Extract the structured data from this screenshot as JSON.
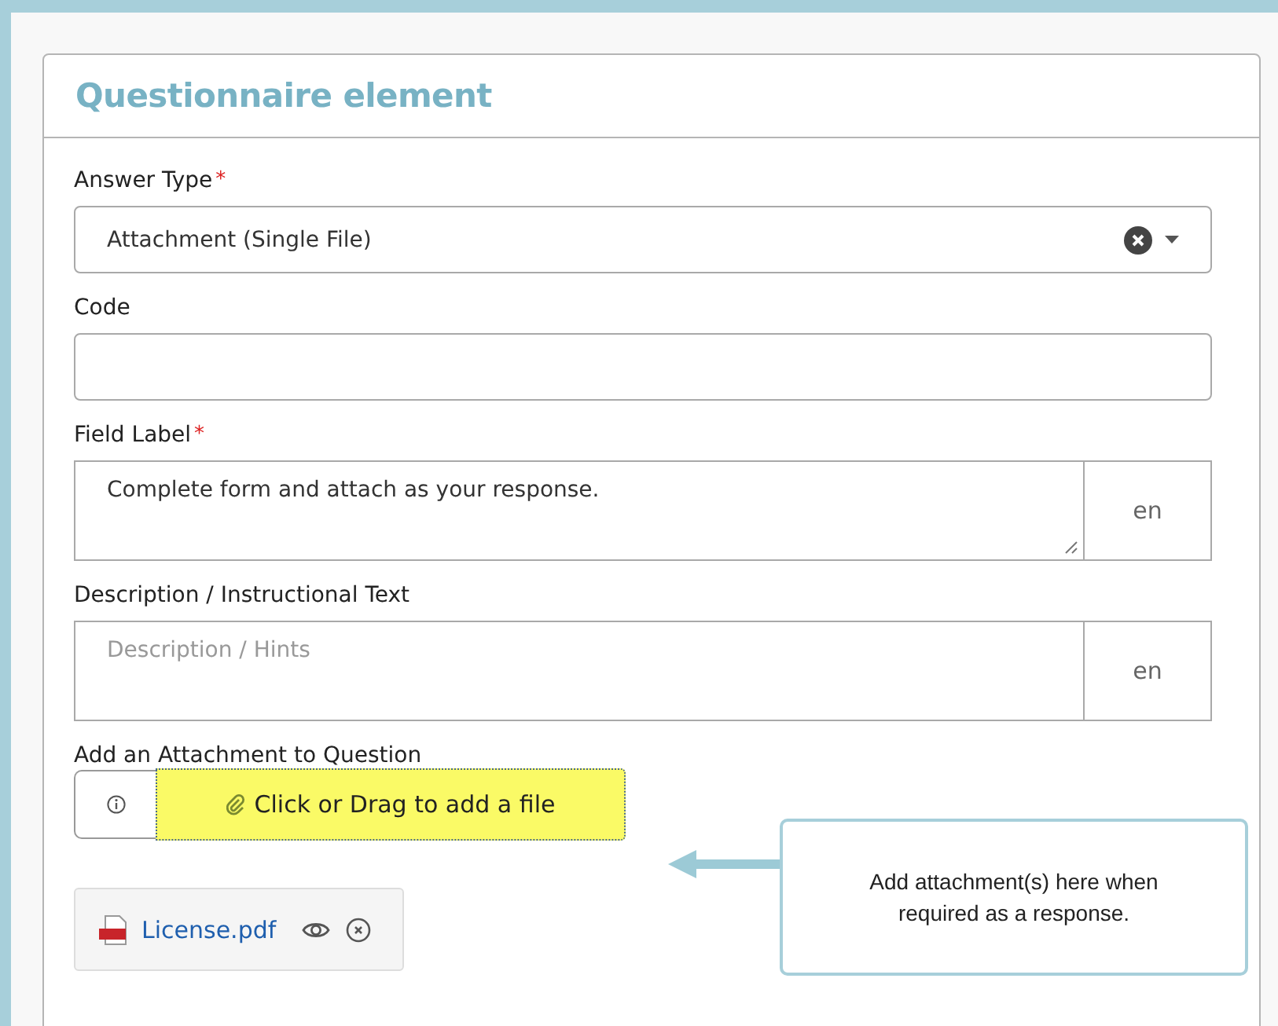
{
  "panel": {
    "title": "Questionnaire element"
  },
  "fields": [
    {
      "kind": "select",
      "label": "Answer Type",
      "required_mark": "*",
      "value": "Attachment (Single File)"
    },
    {
      "kind": "text",
      "label": "Code"
    },
    {
      "kind": "textarea",
      "label": "Field Label",
      "required_mark": "*",
      "value": "Complete form and attach as your response.",
      "lang": "en"
    },
    {
      "kind": "textarea",
      "label": "Description / Instructional Text",
      "placeholder": "Description / Hints",
      "lang": "en"
    }
  ],
  "attachment": {
    "label": "Add an Attachment to Question",
    "button": "Click or Drag to add a file",
    "files": [
      {
        "name": "License.pdf"
      }
    ]
  },
  "callout": {
    "text": "Add attachment(s) here when required as a response."
  }
}
